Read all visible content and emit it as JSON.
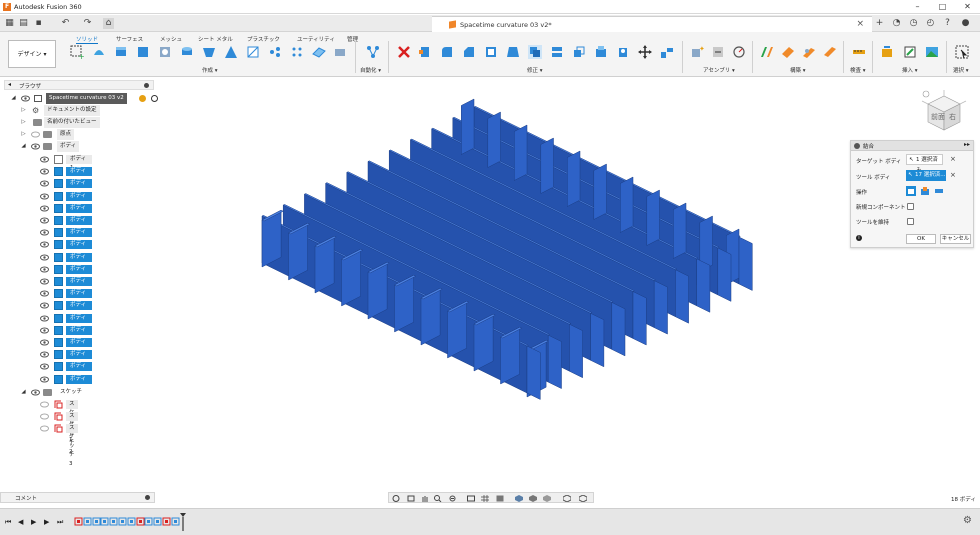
{
  "window": {
    "title": "Autodesk Fusion 360",
    "logo_letter": "F"
  },
  "document": {
    "title": "Spacetime curvature 03 v2*"
  },
  "ribbon": {
    "workspace": "デザイン ▾",
    "tabs": [
      "ソリッド",
      "サーフェス",
      "メッシュ",
      "シート メタル",
      "プラスチック",
      "ユーティリティ",
      "管理"
    ],
    "groups": [
      "作成 ▾",
      "自動化 ▾",
      "修正 ▾",
      "アセンブリ ▾",
      "構築 ▾",
      "検査 ▾",
      "挿入 ▾",
      "選択 ▾"
    ]
  },
  "browser": {
    "title": "ブラウザ",
    "root": "Spacetime curvature 03 v2",
    "items": [
      "ドキュメントの設定",
      "名前の付いたビュー",
      "原点",
      "ボディ"
    ],
    "bodies": [
      "ボディ1",
      "ボディ2",
      "ボディ3",
      "ボディ4",
      "ボディ5",
      "ボディ6",
      "ボディ7",
      "ボディ8",
      "ボディ9",
      "ボディ10",
      "ボディ11",
      "ボディ12",
      "ボディ13",
      "ボディ14",
      "ボディ15",
      "ボディ16",
      "ボディ17",
      "ボディ18",
      "ボディ19"
    ],
    "sketch_folder": "スケッチ",
    "sketches": [
      "スケッチ1",
      "スケッチ2",
      "スケッチ3"
    ]
  },
  "combine_dialog": {
    "title": "結合",
    "target_label": "ターゲット ボディ",
    "target_value": "1 選択済み",
    "tool_label": "ツール ボディ",
    "tool_value": "17 選択済...",
    "operation_label": "操作",
    "new_component_label": "新規コンポーネント",
    "keep_tools_label": "ツールを維持",
    "ok": "OK",
    "cancel": "キャンセル"
  },
  "viewcube": {
    "face_front": "前面",
    "face_right": "右"
  },
  "bottom": {
    "comments": "コメント",
    "body_count": "18 ボディ"
  },
  "colors": {
    "accent": "#1d8bd6",
    "body_blue": "#2e62c7"
  }
}
